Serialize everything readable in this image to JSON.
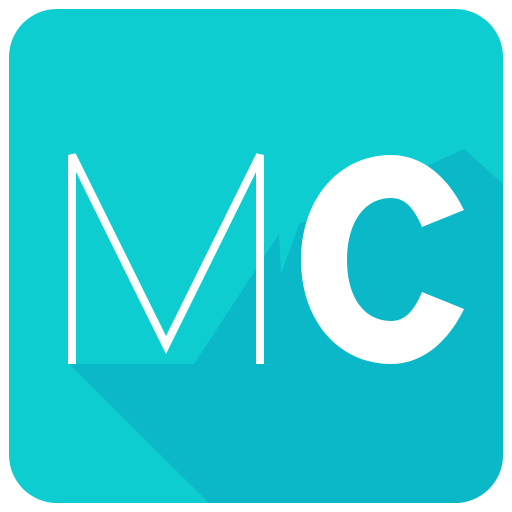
{
  "app_icon": {
    "name": "MC app icon",
    "logo_text": {
      "first_letter": "M",
      "second_letter": "c"
    },
    "colors": {
      "background": "#0ecdd0",
      "long_shadow": "#0bb8c7",
      "letters": "#ffffff"
    }
  }
}
